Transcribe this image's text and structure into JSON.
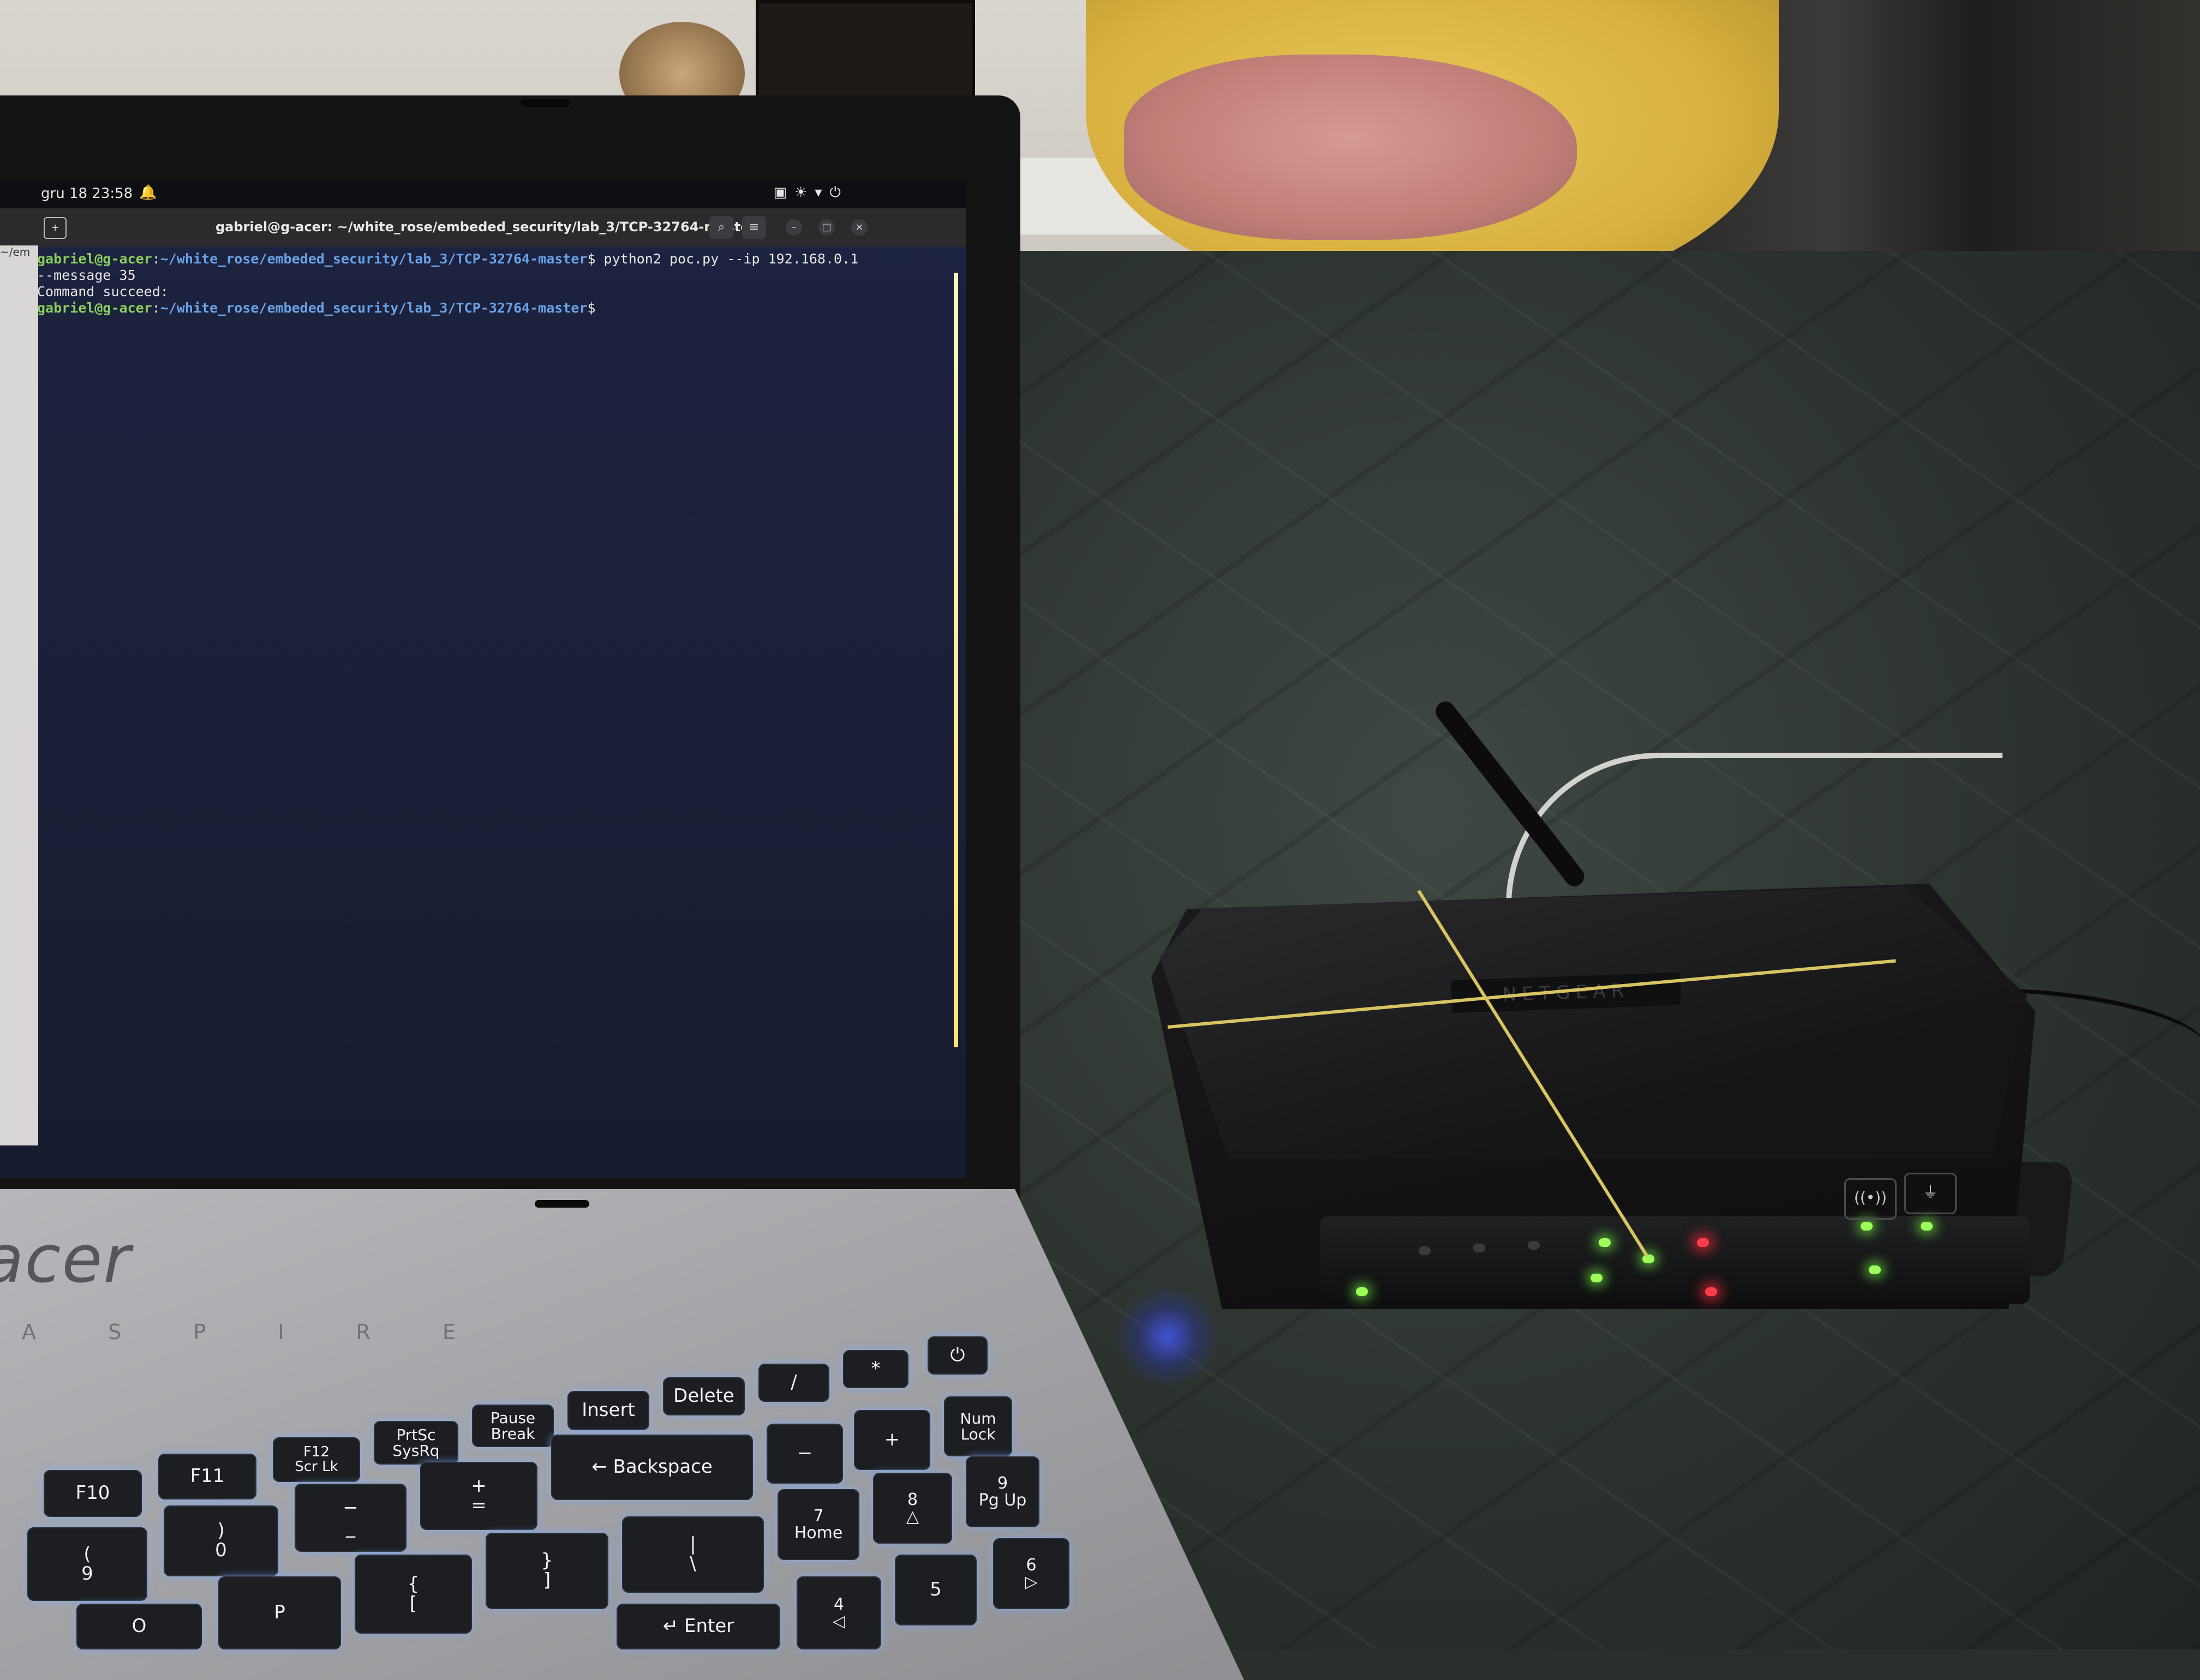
{
  "terminal": {
    "clock": "gru 18  23:58",
    "window_title": "gabriel@g-acer: ~/white_rose/embeded_security/lab_3/TCP-32764-master",
    "left_window_text": "~/em",
    "lines": [
      {
        "user": "gabriel@g-acer",
        "sep": ":",
        "path": "~/white_rose/embeded_security/lab_3/TCP-32764-master",
        "cmd": "$ python2 poc.py --ip 192.168.0.1"
      },
      {
        "text": "--message 35"
      },
      {
        "text": "Command succeed:"
      },
      {
        "user": "gabriel@g-acer",
        "sep": ":",
        "path": "~/white_rose/embeded_security/lab_3/TCP-32764-master",
        "cmd": "$"
      }
    ]
  },
  "laptop": {
    "brand": "acer",
    "model_text": "A S P I R E",
    "keys": {
      "power": "⏻",
      "slash": "/",
      "star": "*",
      "delete": "Delete",
      "insert": "Insert",
      "pause": "Pause\nBreak",
      "prtsc": "PrtSc\nSysRq",
      "f12": "F12\nScr Lk",
      "f11": "F11",
      "f10": "F10",
      "numlock": "Num\nLock",
      "plus": "+",
      "minus": "−",
      "backspace": "← Backspace",
      "plus_eq": "+\n=",
      "minus_us": "−\n_",
      "rparen_0": ")\n0",
      "lparen_9": "(\n9",
      "brace_r": "}\n]",
      "pipe": "|\n\\",
      "seven": "7\nHome",
      "eight": "8\n△",
      "nine": "9\nPg Up",
      "four": "4\n◁",
      "five": "5",
      "six": "6\n▷",
      "enter": "↵ Enter",
      "p": "P",
      "o": "O",
      "brace_l": "{\n["
    }
  },
  "router": {
    "logo": "NETGEAR",
    "wps_label": "((•))",
    "wifi_label": "⏚",
    "led_colors": {
      "green": "#9cff5a",
      "red": "#ff3b4a"
    }
  }
}
